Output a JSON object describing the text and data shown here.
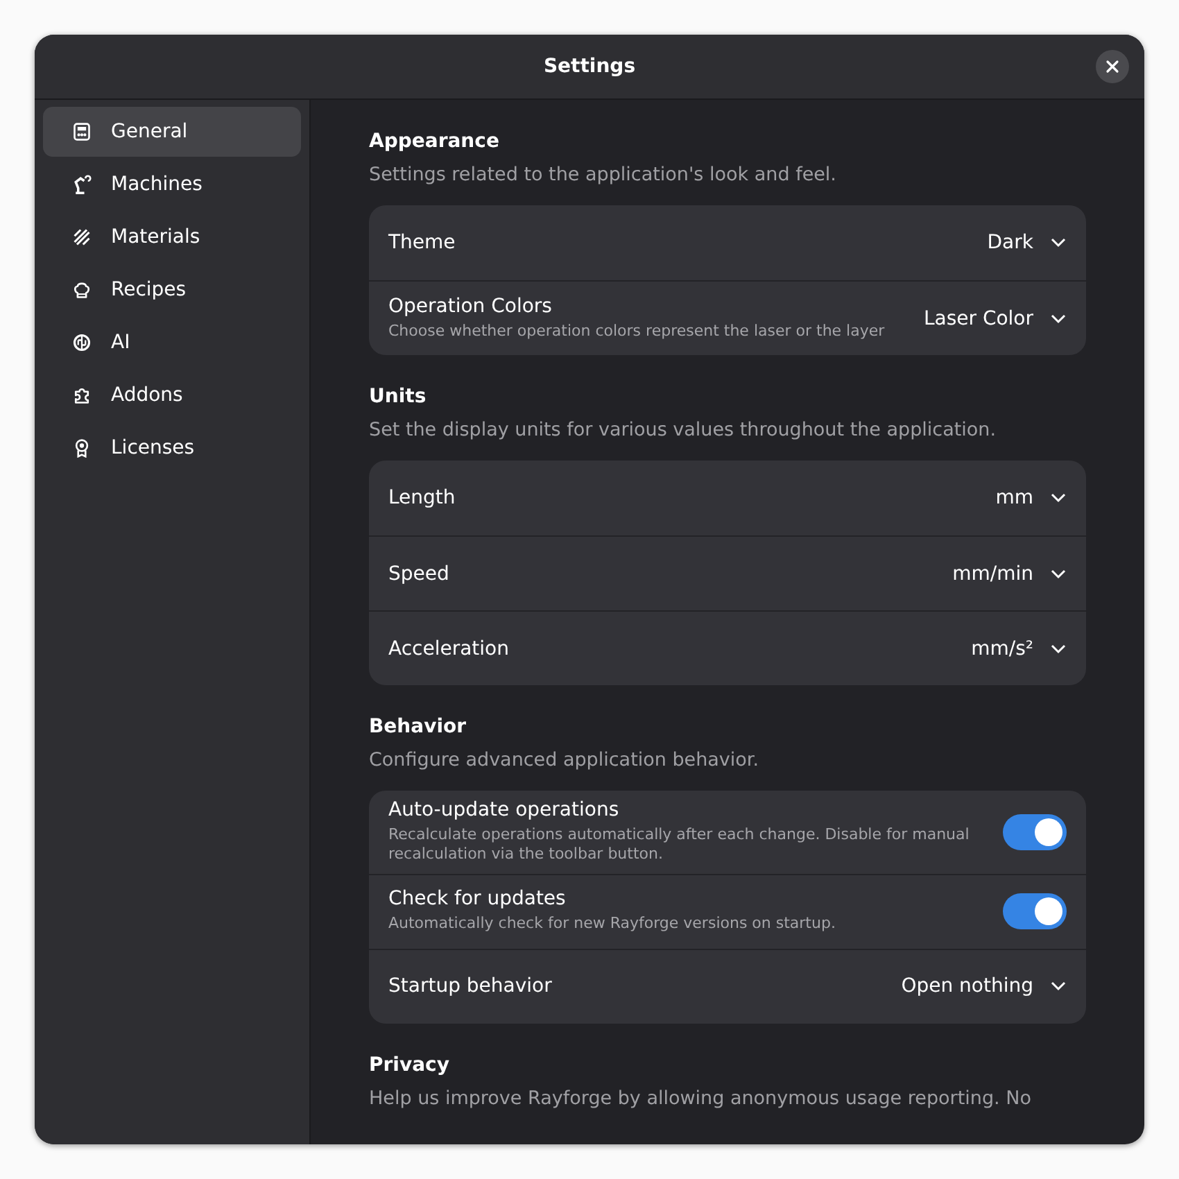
{
  "window": {
    "title": "Settings"
  },
  "sidebar": {
    "items": [
      {
        "label": "General",
        "selected": true
      },
      {
        "label": "Machines",
        "selected": false
      },
      {
        "label": "Materials",
        "selected": false
      },
      {
        "label": "Recipes",
        "selected": false
      },
      {
        "label": "AI",
        "selected": false
      },
      {
        "label": "Addons",
        "selected": false
      },
      {
        "label": "Licenses",
        "selected": false
      }
    ]
  },
  "sections": [
    {
      "title": "Appearance",
      "description": "Settings related to the application's look and feel.",
      "rows": [
        {
          "kind": "dropdown",
          "label": "Theme",
          "value": "Dark"
        },
        {
          "kind": "dropdown",
          "label": "Operation Colors",
          "subtitle": "Choose whether operation colors represent the laser or the layer",
          "value": "Laser Color"
        }
      ]
    },
    {
      "title": "Units",
      "description": "Set the display units for various values throughout the application.",
      "rows": [
        {
          "kind": "dropdown",
          "label": "Length",
          "value": "mm"
        },
        {
          "kind": "dropdown",
          "label": "Speed",
          "value": "mm/min"
        },
        {
          "kind": "dropdown",
          "label": "Acceleration",
          "value": "mm/s²"
        }
      ]
    },
    {
      "title": "Behavior",
      "description": "Configure advanced application behavior.",
      "rows": [
        {
          "kind": "switch",
          "label": "Auto-update operations",
          "subtitle": "Recalculate operations automatically after each change. Disable for manual recalculation via the toolbar button.",
          "on": true
        },
        {
          "kind": "switch",
          "label": "Check for updates",
          "subtitle": "Automatically check for new Rayforge versions on startup.",
          "on": true
        },
        {
          "kind": "dropdown",
          "label": "Startup behavior",
          "value": "Open nothing"
        }
      ]
    },
    {
      "title": "Privacy",
      "description": "Help us improve Rayforge by allowing anonymous usage reporting. No"
    }
  ]
}
